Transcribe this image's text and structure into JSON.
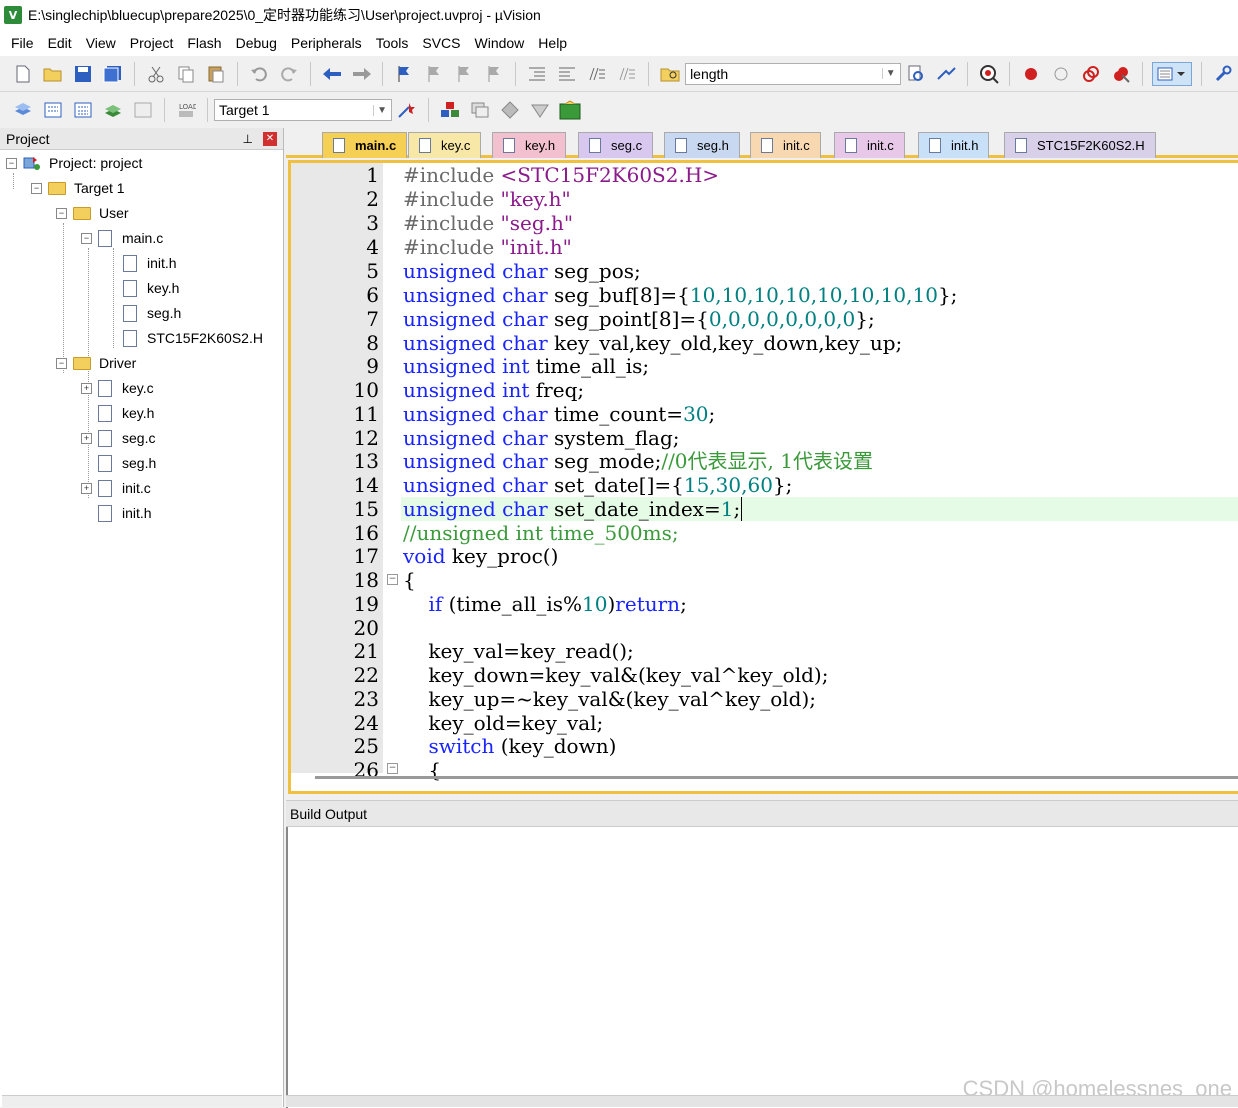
{
  "window": {
    "title": "E:\\singlechip\\bluecup\\prepare2025\\0_定时器功能练习\\User\\project.uvproj - µVision",
    "app_icon": "V"
  },
  "menu": [
    "File",
    "Edit",
    "View",
    "Project",
    "Flash",
    "Debug",
    "Peripherals",
    "Tools",
    "SVCS",
    "Window",
    "Help"
  ],
  "toolbar": {
    "find_value": "length",
    "target_value": "Target 1"
  },
  "project_panel": {
    "title": "Project",
    "tree": {
      "project": "Project: project",
      "target": "Target 1",
      "user_group": "User",
      "user_files": [
        "main.c",
        "init.h",
        "key.h",
        "seg.h",
        "STC15F2K60S2.H"
      ],
      "driver_group": "Driver",
      "driver_files": [
        "key.c",
        "key.h",
        "seg.c",
        "seg.h",
        "init.c",
        "init.h"
      ]
    }
  },
  "tabs": [
    "main.c",
    "key.c",
    "key.h",
    "seg.c",
    "seg.h",
    "init.c",
    "init.c",
    "init.h",
    "STC15F2K60S2.H"
  ],
  "active_tab": "main.c",
  "line_numbers": [
    "1",
    "2",
    "3",
    "4",
    "5",
    "6",
    "7",
    "8",
    "9",
    "10",
    "11",
    "12",
    "13",
    "14",
    "15",
    "16",
    "17",
    "18",
    "19",
    "20",
    "21",
    "22",
    "23",
    "24",
    "25",
    "26"
  ],
  "code": {
    "l1": [
      "#include ",
      "<STC15F2K60S2.H>"
    ],
    "l2": [
      "#include ",
      "\"key.h\""
    ],
    "l3": [
      "#include ",
      "\"seg.h\""
    ],
    "l4": [
      "#include ",
      "\"init.h\""
    ],
    "l5": [
      "unsigned char",
      " seg_pos;"
    ],
    "l6": [
      "unsigned char",
      " seg_buf[8]={",
      "10,10,10,10,10,10,10,10",
      "};"
    ],
    "l7": [
      "unsigned char",
      " seg_point[8]={",
      "0,0,0,0,0,0,0,0",
      "};"
    ],
    "l8": [
      "unsigned char",
      " key_val,key_old,key_down,key_up;"
    ],
    "l9": [
      "unsigned int",
      " time_all_is;"
    ],
    "l10": [
      "unsigned int",
      " freq;"
    ],
    "l11": [
      "unsigned char",
      " time_count=",
      "30",
      ";"
    ],
    "l12": [
      "unsigned char",
      " system_flag;"
    ],
    "l13": [
      "unsigned char",
      " seg_mode;",
      "//0代表显示, 1代表设置"
    ],
    "l14": [
      "unsigned char",
      " set_date[]={",
      "15,30,60",
      "};"
    ],
    "l15": [
      "unsigned char",
      " set_date_index=",
      "1",
      ";"
    ],
    "l16": [
      "//unsigned int time_500ms;"
    ],
    "l17": [
      "void",
      " key_proc()"
    ],
    "l18": [
      "{"
    ],
    "l19": [
      "    ",
      "if",
      " (time_all_is%",
      "10",
      ")",
      "return",
      ";"
    ],
    "l20": [
      ""
    ],
    "l21": [
      "    key_val=key_read();"
    ],
    "l22": [
      "    key_down=key_val&(key_val^key_old);"
    ],
    "l23": [
      "    key_up=~key_val&(key_val^key_old);"
    ],
    "l24": [
      "    key_old=key_val;"
    ],
    "l25": [
      "    ",
      "switch",
      " (key_down)"
    ],
    "l26": [
      "    {"
    ]
  },
  "output_panel": {
    "title": "Build Output",
    "watermark": "CSDN @homelessnes_one"
  }
}
